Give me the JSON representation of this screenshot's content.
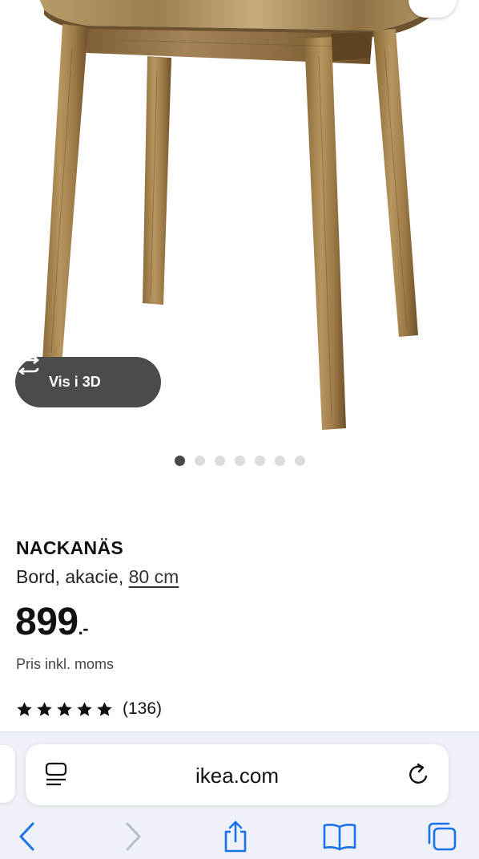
{
  "image_viewer": {
    "view_3d_label": "Vis i 3D",
    "dots_total": 7,
    "active_dot": 0
  },
  "product": {
    "name": "NACKANÄS",
    "description_prefix": "Bord, akacie, ",
    "size_link": "80 cm",
    "price": "899",
    "price_suffix": ".-",
    "price_note": "Pris inkl. moms",
    "rating_value": 5,
    "rating_count": "(136)"
  },
  "browser": {
    "url": "ikea.com"
  },
  "icons": {
    "favorite": "heart-icon",
    "view_3d": "rotate-3d-icon",
    "star": "star-icon",
    "reader": "reader-icon",
    "reload": "reload-icon",
    "back": "chevron-left-icon",
    "forward": "chevron-right-icon",
    "share": "share-icon",
    "bookmarks": "book-icon",
    "tabs": "tabs-icon"
  },
  "colors": {
    "accent_blue": "#1a73e8",
    "text_primary": "#111111",
    "chip_bg": "#4b4b4b",
    "dot_active": "#484848",
    "dot_inactive": "#dcdcdc",
    "toolbar_bg": "#eef1f8"
  }
}
